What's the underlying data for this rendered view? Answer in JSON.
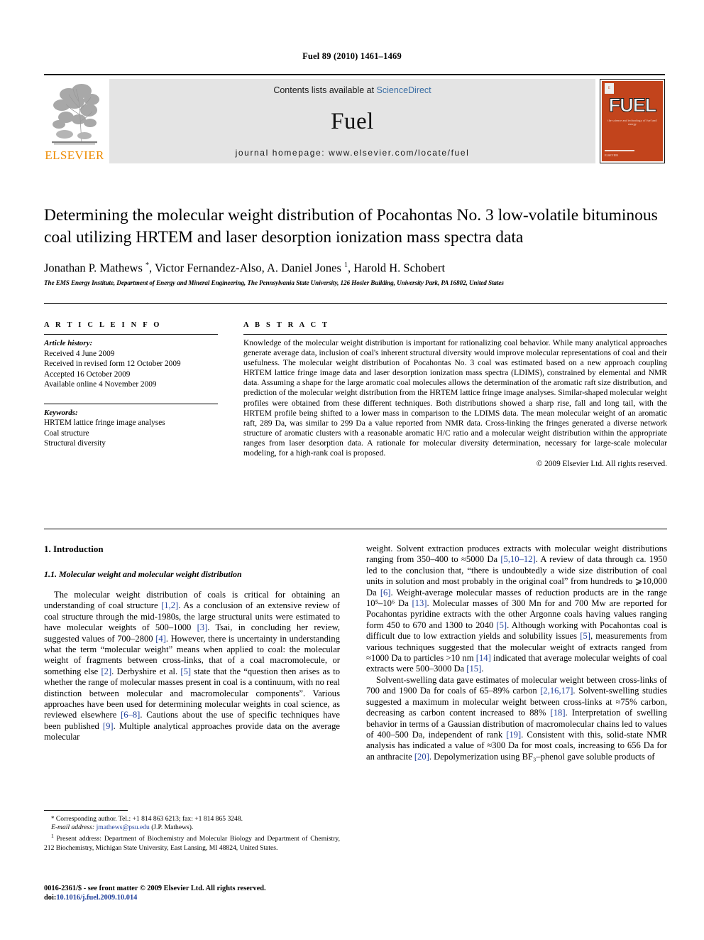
{
  "running_head": "Fuel 89 (2010) 1461–1469",
  "masthead": {
    "publisher_name": "ELSEVIER",
    "contents_prefix": "Contents lists available at ",
    "contents_link": "ScienceDirect",
    "journal_name": "Fuel",
    "homepage_line": "journal homepage: www.elsevier.com/locate/fuel",
    "cover": {
      "title": "FUEL",
      "subtitle": "the science and technology of fuel and energy",
      "footer": "ELSEVIER"
    },
    "accent_link_color": "#3a6ea5",
    "elsevier_orange": "#ED8B00",
    "cover_orange": "#c2441c"
  },
  "article": {
    "title": "Determining the molecular weight distribution of Pocahontas No. 3 low-volatile bituminous coal utilizing HRTEM and laser desorption ionization mass spectra data",
    "authors": "Jonathan P. Mathews *, Victor Fernandez-Also, A. Daniel Jones 1, Harold H. Schobert",
    "affiliation": "The EMS Energy Institute, Department of Energy and Mineral Engineering, The Pennsylvania State University, 126 Hosler Building, University Park, PA 16802, United States"
  },
  "article_info": {
    "heading": "A R T I C L E   I N F O",
    "history_label": "Article history:",
    "history": [
      "Received 4 June 2009",
      "Received in revised form 12 October 2009",
      "Accepted 16 October 2009",
      "Available online 4 November 2009"
    ],
    "keywords_label": "Keywords:",
    "keywords": [
      "HRTEM lattice fringe image analyses",
      "Coal structure",
      "Structural diversity"
    ]
  },
  "abstract": {
    "heading": "A B S T R A C T",
    "text": "Knowledge of the molecular weight distribution is important for rationalizing coal behavior. While many analytical approaches generate average data, inclusion of coal's inherent structural diversity would improve molecular representations of coal and their usefulness. The molecular weight distribution of Pocahontas No. 3 coal was estimated based on a new approach coupling HRTEM lattice fringe image data and laser desorption ionization mass spectra (LDIMS), constrained by elemental and NMR data. Assuming a shape for the large aromatic coal molecules allows the determination of the aromatic raft size distribution, and prediction of the molecular weight distribution from the HRTEM lattice fringe image analyses. Similar-shaped molecular weight profiles were obtained from these different techniques. Both distributions showed a sharp rise, fall and long tail, with the HRTEM profile being shifted to a lower mass in comparison to the LDIMS data. The mean molecular weight of an aromatic raft, 289 Da, was similar to 299 Da a value reported from NMR data. Cross-linking the fringes generated a diverse network structure of aromatic clusters with a reasonable aromatic H/C ratio and a molecular weight distribution within the appropriate ranges from laser desorption data. A rationale for molecular diversity determination, necessary for large-scale molecular modeling, for a high-rank coal is proposed.",
    "copyright": "© 2009 Elsevier Ltd. All rights reserved."
  },
  "body": {
    "section_heading": "1. Introduction",
    "subsection_heading": "1.1. Molecular weight and molecular weight distribution",
    "left_paragraph_1": "The molecular weight distribution of coals is critical for obtaining an understanding of coal structure [1,2]. As a conclusion of an extensive review of coal structure through the mid-1980s, the large structural units were estimated to have molecular weights of 500–1000 [3]. Tsai, in concluding her review, suggested values of 700–2800 [4]. However, there is uncertainty in understanding what the term “molecular weight” means when applied to coal: the molecular weight of fragments between cross-links, that of a coal macromolecule, or something else [2]. Derbyshire et al. [5] state that the “question then arises as to whether the range of molecular masses present in coal is a continuum, with no real distinction between molecular and macromolecular components”. Various approaches have been used for determining molecular weights in coal science, as reviewed elsewhere [6–8]. Cautions about the use of specific techniques have been published [9]. Multiple analytical approaches provide data on the average molecular",
    "right_paragraph_1": "weight. Solvent extraction produces extracts with molecular weight distributions ranging from 350–400 to ≈5000 Da [5,10–12]. A review of data through ca. 1950 led to the conclusion that, “there is undoubtedly a wide size distribution of coal units in solution and most probably in the original coal” from hundreds to ⩾10,000 Da [6]. Weight-average molecular masses of reduction products are in the range 10⁵–10⁶ Da [13]. Molecular masses of 300 Mn for and 700 Mw are reported for Pocahontas pyridine extracts with the other Argonne coals having values ranging form 450 to 670 and 1300 to 2040 [5]. Although working with Pocahontas coal is difficult due to low extraction yields and solubility issues [5], measurements from various techniques suggested that the molecular weight of extracts ranged from ≈1000 Da to particles >10 nm [14] indicated that average molecular weights of coal extracts were 500–3000 Da [15].",
    "right_paragraph_2": "Solvent-swelling data gave estimates of molecular weight between cross-links of 700 and 1900 Da for coals of 65–89% carbon [2,16,17]. Solvent-swelling studies suggested a maximum in molecular weight between cross-links at ≈75% carbon, decreasing as carbon content increased to 88% [18]. Interpretation of swelling behavior in terms of a Gaussian distribution of macromolecular chains led to values of 400–500 Da, independent of rank [19]. Consistent with this, solid-state NMR analysis has indicated a value of ≈300 Da for most coals, increasing to 656 Da for an anthracite [20]. Depolymerization using BF₃–phenol gave soluble products of"
  },
  "footnotes": {
    "corresponding": "Corresponding author. Tel.: +1 814 863 6213; fax: +1 814 865 3248.",
    "email_label": "E-mail address:",
    "email": "jmathews@psu.edu",
    "email_suffix": "(J.P. Mathews).",
    "present_address": "Present address: Department of Biochemistry and Molecular Biology and Department of Chemistry, 212 Biochemistry, Michigan State University, East Lansing, MI 48824, United States."
  },
  "imprint": {
    "issn_line": "0016-2361/$ - see front matter © 2009 Elsevier Ltd. All rights reserved.",
    "doi_label": "doi:",
    "doi_value": "10.1016/j.fuel.2009.10.014"
  }
}
